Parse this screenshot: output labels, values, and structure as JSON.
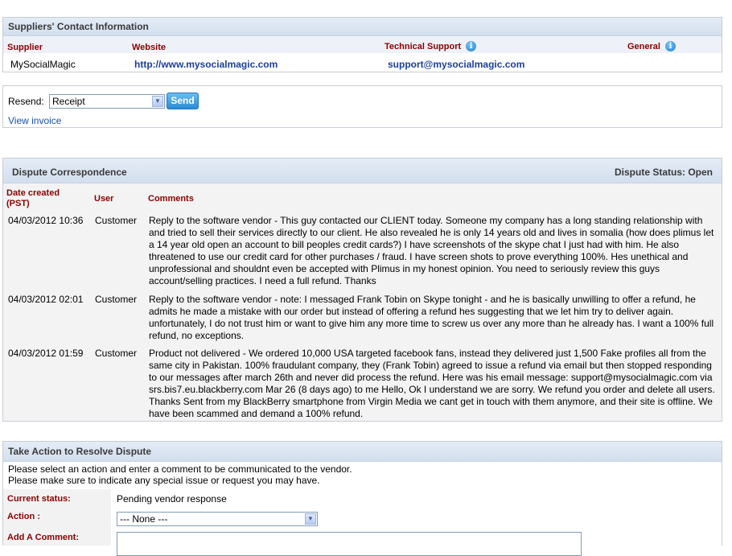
{
  "suppliers": {
    "title": "Suppliers' Contact Information",
    "col_supplier": "Supplier",
    "col_website": "Website",
    "col_tech": "Technical Support",
    "col_general": "General",
    "supplier_name": "MySocialMagic",
    "website": "http://www.mysocialmagic.com",
    "tech_email": "support@mysocialmagic.com",
    "info_icon_glyph": "i"
  },
  "resend": {
    "label": "Resend:",
    "selected": "Receipt",
    "send_label": "Send",
    "view_invoice": "View invoice"
  },
  "dispute": {
    "title": "Dispute Correspondence",
    "status": "Dispute Status: Open",
    "col_date": "Date created (PST)",
    "col_user": "User",
    "col_comments": "Comments",
    "rows": [
      {
        "date": "04/03/2012 10:36",
        "user": "Customer",
        "comment": "Reply to the software vendor - This guy contacted our CLIENT today. Someone my company has a long standing relationship with and tried to sell their services directly to our client. He also revealed he is only 14 years old and lives in somalia (how does plimus let a 14 year old open an account to bill peoples credit cards?) I have screenshots of the skype chat I just had with him. He also threatened to use our credit card for other purchases / fraud. I have screen shots to prove everything 100%. Hes unethical and unprofessional and shouldnt even be accepted with Plimus in my honest opinion. You need to seriously review this guys account/selling practices. I need a full refund. Thanks"
      },
      {
        "date": "04/03/2012 02:01",
        "user": "Customer",
        "comment": "Reply to the software vendor - note: I messaged Frank Tobin on Skype tonight - and he is basically unwilling to offer a refund, he admits he made a mistake with our order but instead of offering a refund hes suggesting that we let him try to deliver again. unfortunately, I do not trust him or want to give him any more time to screw us over any more than he already has. I want a 100% full refund, no exceptions."
      },
      {
        "date": "04/03/2012 01:59",
        "user": "Customer",
        "comment": "Product not delivered - We ordered 10,000 USA targeted facebook fans, instead they delivered just 1,500 Fake profiles all from the same city in Pakistan. 100% fraudulant company, they (Frank Tobin) agreed to issue a refund via email but then stopped responding to our messages after march 26th and never did process the refund. Here was his email message: support@mysocialmagic.com via srs.bis7.eu.blackberry.com Mar 26 (8 days ago) to me Hello, Ok I understand we are sorry. We refund you order and delete all users. Thanks Sent from my BlackBerry smartphone from Virgin Media we cant get in touch with them anymore, and their site is offline. We have been scammed and demand a 100% refund."
      }
    ]
  },
  "action": {
    "title": "Take Action to Resolve Dispute",
    "intro1": "Please select an action and enter a comment to be communicated to the vendor.",
    "intro2": "Please make sure to indicate any special issue or request you may have.",
    "status_label": "Current status:",
    "status_value": "Pending vendor response",
    "action_label": "Action :",
    "action_selected": "--- None ---",
    "comment_label": "Add A Comment:"
  }
}
